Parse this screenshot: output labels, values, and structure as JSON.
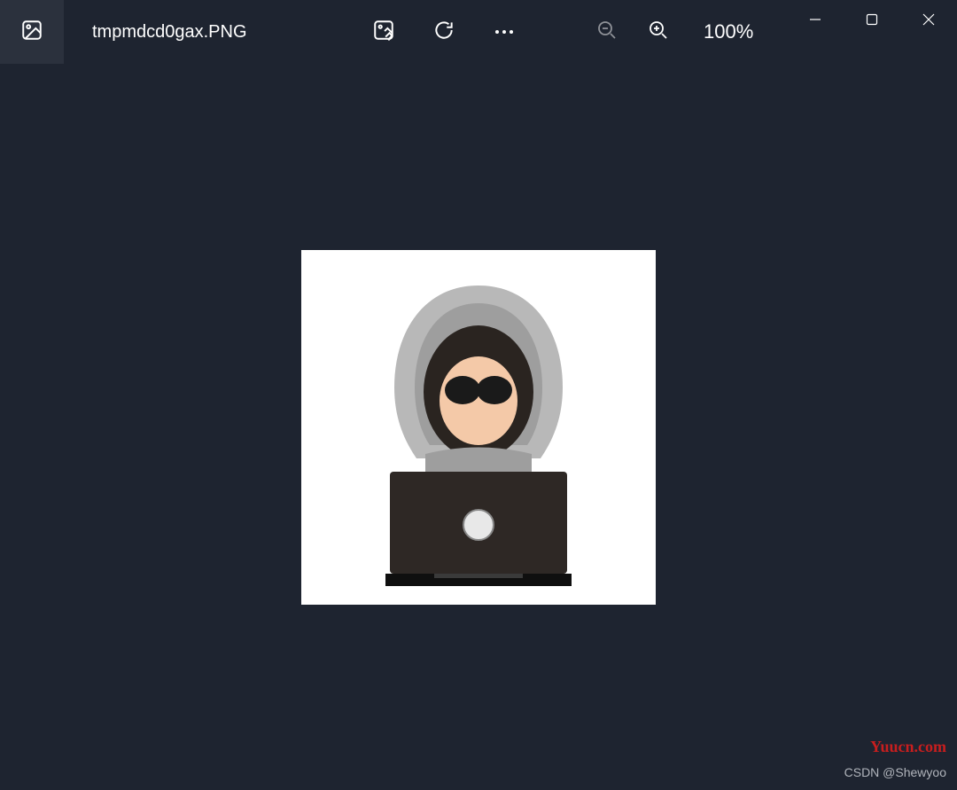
{
  "titlebar": {
    "filename": "tmpmdcd0gax.PNG",
    "zoom_level": "100%"
  },
  "image": {
    "description": "hacker with laptop illustration"
  },
  "watermarks": {
    "site": "Yuucn.com",
    "author": "CSDN @Shewyoo"
  }
}
